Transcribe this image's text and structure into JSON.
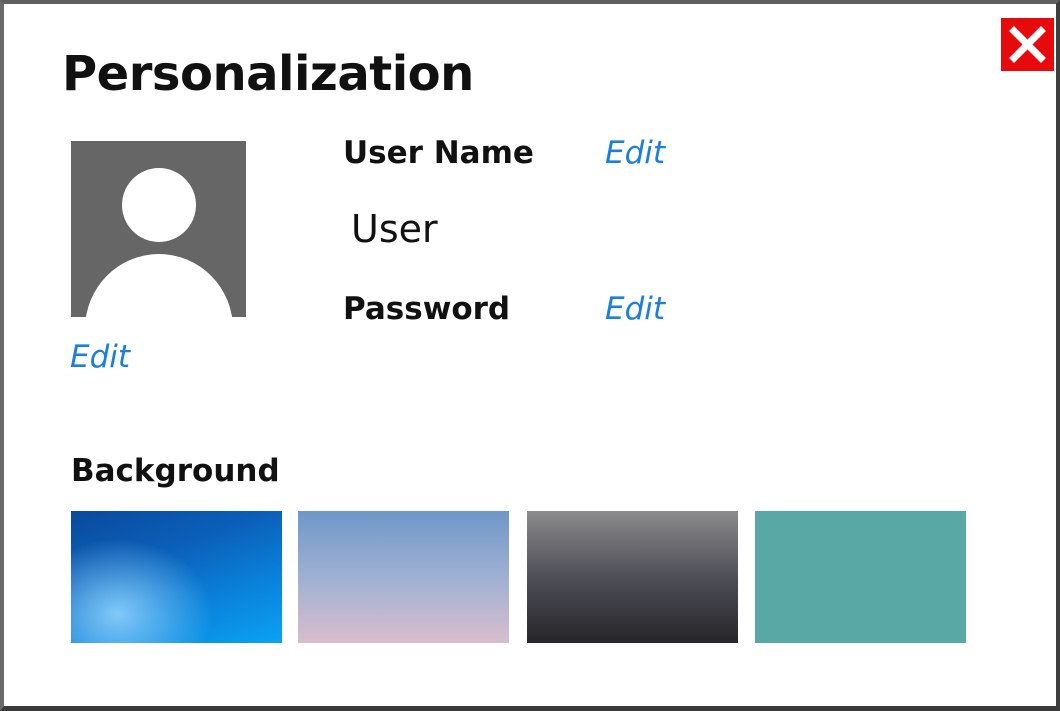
{
  "dialog": {
    "title": "Personalization",
    "close_icon": "close-icon"
  },
  "avatar": {
    "icon": "user-silhouette-icon",
    "edit_label": "Edit"
  },
  "user_name": {
    "label": "User Name",
    "edit_label": "Edit",
    "value": "User"
  },
  "password": {
    "label": "Password",
    "edit_label": "Edit"
  },
  "background": {
    "label": "Background",
    "options": [
      {
        "name": "blue-light-burst",
        "colors": [
          "#0a4a9c",
          "#0ba2f3",
          "#96d7ff"
        ]
      },
      {
        "name": "blue-pink-gradient",
        "colors": [
          "#6f97c8",
          "#d9bdcd"
        ]
      },
      {
        "name": "gray-charcoal-gradient",
        "colors": [
          "#8b8b8b",
          "#26262a"
        ]
      },
      {
        "name": "teal-solid",
        "colors": [
          "#5aa8a6"
        ]
      }
    ]
  },
  "colors": {
    "link": "#1b7fe0",
    "close_button": "#e8090c",
    "avatar_bg": "#666666",
    "avatar_fg": "#ffffff"
  }
}
